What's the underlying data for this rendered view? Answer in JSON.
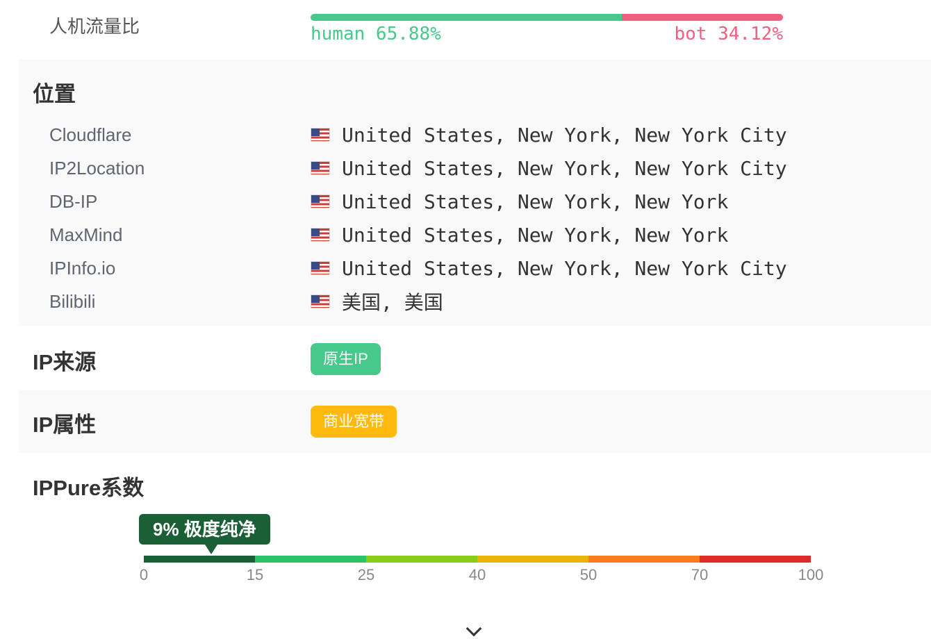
{
  "traffic": {
    "label": "人机流量比",
    "human_text": "human 65.88%",
    "bot_text": "bot 34.12%",
    "human_pct": 65.88,
    "bot_pct": 34.12,
    "human_color": "#47c98b",
    "bot_color": "#f2607f"
  },
  "location": {
    "title": "位置",
    "rows": [
      {
        "source": "Cloudflare",
        "flag": "us-flag-icon",
        "value": "United States, New York, New York City"
      },
      {
        "source": "IP2Location",
        "flag": "us-flag-icon",
        "value": "United States, New York, New York City"
      },
      {
        "source": "DB-IP",
        "flag": "us-flag-icon",
        "value": "United States, New York, New York"
      },
      {
        "source": "MaxMind",
        "flag": "us-flag-icon",
        "value": "United States, New York, New York"
      },
      {
        "source": "IPInfo.io",
        "flag": "us-flag-icon",
        "value": "United States, New York, New York City"
      },
      {
        "source": "Bilibili",
        "flag": "us-flag-icon",
        "value": "美国, 美国"
      }
    ]
  },
  "ip_source": {
    "title": "IP来源",
    "badge": "原生IP",
    "color": "#47c98b"
  },
  "ip_type": {
    "title": "IP属性",
    "badge": "商业宽带",
    "color": "#ffba10"
  },
  "ippure": {
    "title": "IPPure系数",
    "score": 9,
    "tag": "9% 极度纯净",
    "scale_max": 100,
    "segments": [
      {
        "from": 0,
        "to": 15,
        "color": "#1a5f36"
      },
      {
        "from": 15,
        "to": 25,
        "color": "#2cc46a"
      },
      {
        "from": 25,
        "to": 40,
        "color": "#8bcc1a"
      },
      {
        "from": 40,
        "to": 50,
        "color": "#e8b40a"
      },
      {
        "from": 50,
        "to": 70,
        "color": "#fa7b1c"
      },
      {
        "from": 70,
        "to": 100,
        "color": "#df2a2a"
      }
    ],
    "ticks": [
      "0",
      "15",
      "25",
      "40",
      "50",
      "70",
      "100"
    ]
  },
  "expand_icon": "chevron-down-icon"
}
